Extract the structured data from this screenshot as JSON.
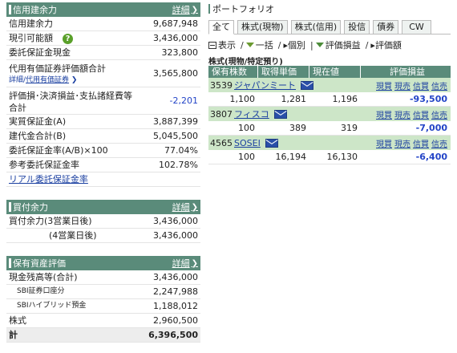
{
  "left": {
    "margin_section": {
      "title": "信用建余力",
      "detail": "詳細",
      "rows": [
        {
          "label": "信用建余力",
          "value": "9,687,948"
        },
        {
          "label": "現引可能額",
          "value": "3,436,000"
        },
        {
          "label": "委託保証金現金",
          "value": "323,800"
        },
        {
          "label": "代用有価証券評価額合計",
          "value": "3,565,800",
          "sub_prefix": "詳細/",
          "sub_link": "代用有価証券"
        },
        {
          "label": "評価損･決済損益･支払諸経費等",
          "label2": "合計",
          "value": "-2,201"
        },
        {
          "label": "実質保証金(A)",
          "value": "3,887,399"
        },
        {
          "label": "建代金合計(B)",
          "value": "5,045,500"
        },
        {
          "label": "委託保証金率(A/B)×100",
          "value": "77.04%"
        },
        {
          "label": "参考委託保証金率",
          "value": "102.78%"
        }
      ],
      "footer_link": "リアル委託保証金率"
    },
    "buy_section": {
      "title": "買付余力",
      "detail": "詳細",
      "rows": [
        {
          "label": "買付余力(3営業日後)",
          "value": "3,436,000"
        },
        {
          "label": "(4営業日後)",
          "value": "3,436,000"
        }
      ]
    },
    "assets_section": {
      "title": "保有資産評価",
      "detail": "詳細",
      "rows": [
        {
          "label": "現金残高等(合計)",
          "value": "3,436,000"
        },
        {
          "label": "SBI証券口座分",
          "value": "2,247,988"
        },
        {
          "label": "SBIハイブリッド預金",
          "value": "1,188,012"
        },
        {
          "label": "株式",
          "value": "2,960,500"
        }
      ],
      "total": {
        "label": "計",
        "value": "6,396,500"
      }
    }
  },
  "portfolio": {
    "title": "ポートフォリオ",
    "tabs": [
      "全て",
      "株式(現物)",
      "株式(信用)",
      "投信",
      "債券",
      "CW"
    ],
    "toolbar": {
      "display": "表示",
      "bulk": "一括",
      "individual": "個別",
      "eval_pl": "評価損益",
      "eval_amount": "評価額"
    },
    "group_title": "株式(現物/特定預り)",
    "columns": [
      "保有株数",
      "取得単価",
      "現在値",
      "評価損益"
    ],
    "action_labels": [
      "現買",
      "現売",
      "信買",
      "信売"
    ],
    "holdings": [
      {
        "code": "3539",
        "name": "ジャパンミート",
        "shares": "1,100",
        "cost": "1,281",
        "price": "1,196",
        "pl": "-93,500"
      },
      {
        "code": "3807",
        "name": "フィスコ",
        "shares": "100",
        "cost": "389",
        "price": "319",
        "pl": "-7,000"
      },
      {
        "code": "4565",
        "name": "SOSEI",
        "shares": "100",
        "cost": "16,194",
        "price": "16,130",
        "pl": "-6,400"
      }
    ]
  },
  "colors": {
    "header_bg": "#5a8b7a",
    "row_highlight": "#cde6c8",
    "negative": "#2344c7",
    "link": "#1a3fa0"
  }
}
